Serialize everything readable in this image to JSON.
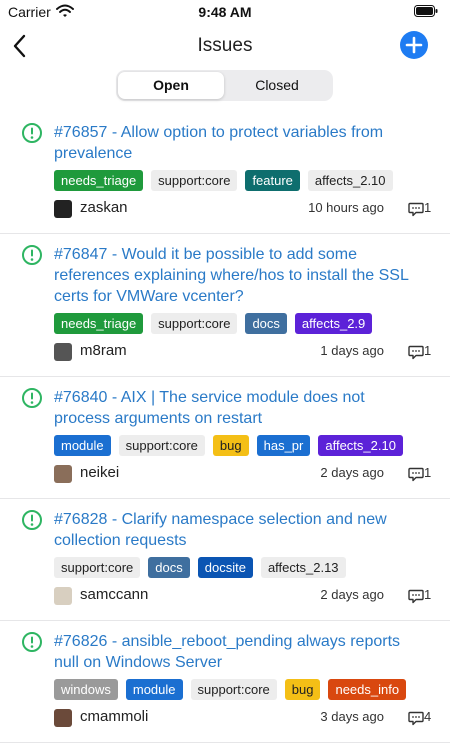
{
  "status_bar": {
    "carrier": "Carrier",
    "time": "9:48 AM"
  },
  "nav": {
    "title": "Issues"
  },
  "tabs": [
    {
      "label": "Open",
      "selected": true
    },
    {
      "label": "Closed",
      "selected": false
    }
  ],
  "colors": {
    "accent": "#1e7cf2",
    "issue_link": "#2a7ac7",
    "open_icon": "#2eb562"
  },
  "issues": [
    {
      "title": "#76857 - Allow option to protect variables from prevalence",
      "labels": [
        {
          "text": "needs_triage",
          "bg": "#1f9a3c",
          "fg": "#ffffff"
        },
        {
          "text": "support:core",
          "bg": "#ededed",
          "fg": "#222222"
        },
        {
          "text": "feature",
          "bg": "#0e6e6e",
          "fg": "#ffffff"
        },
        {
          "text": "affects_2.10",
          "bg": "#ededed",
          "fg": "#222222"
        }
      ],
      "author": "zaskan",
      "avatar_color": "#222222",
      "time": "10 hours ago",
      "comments": "1"
    },
    {
      "title": "#76847 - Would it be possible to add some references explaining where/hos to install the SSL certs for VMWare vcenter?",
      "labels": [
        {
          "text": "needs_triage",
          "bg": "#1f9a3c",
          "fg": "#ffffff"
        },
        {
          "text": "support:core",
          "bg": "#ededed",
          "fg": "#222222"
        },
        {
          "text": "docs",
          "bg": "#3f6f9f",
          "fg": "#ffffff"
        },
        {
          "text": "affects_2.9",
          "bg": "#5c22d8",
          "fg": "#ffffff"
        }
      ],
      "author": "m8ram",
      "avatar_color": "#555555",
      "time": "1 days ago",
      "comments": "1"
    },
    {
      "title": "#76840 - AIX | The service module does not process arguments on restart",
      "labels": [
        {
          "text": "module",
          "bg": "#1b6fd1",
          "fg": "#ffffff"
        },
        {
          "text": "support:core",
          "bg": "#ededed",
          "fg": "#222222"
        },
        {
          "text": "bug",
          "bg": "#f4bf16",
          "fg": "#222222"
        },
        {
          "text": "has_pr",
          "bg": "#1b6fd1",
          "fg": "#ffffff"
        },
        {
          "text": "affects_2.10",
          "bg": "#5c22d8",
          "fg": "#ffffff"
        }
      ],
      "author": "neikei",
      "avatar_color": "#8a6e5a",
      "time": "2 days ago",
      "comments": "1"
    },
    {
      "title": "#76828 - Clarify namespace selection and new collection requests",
      "labels": [
        {
          "text": "support:core",
          "bg": "#ededed",
          "fg": "#222222"
        },
        {
          "text": "docs",
          "bg": "#3f6f9f",
          "fg": "#ffffff"
        },
        {
          "text": "docsite",
          "bg": "#0b55b3",
          "fg": "#ffffff"
        },
        {
          "text": "affects_2.13",
          "bg": "#ededed",
          "fg": "#222222"
        }
      ],
      "author": "samccann",
      "avatar_color": "#d8cfc0",
      "time": "2 days ago",
      "comments": "1"
    },
    {
      "title": "#76826 - ansible_reboot_pending always reports null on Windows Server",
      "labels": [
        {
          "text": "windows",
          "bg": "#9a9a9a",
          "fg": "#ffffff"
        },
        {
          "text": "module",
          "bg": "#1b6fd1",
          "fg": "#ffffff"
        },
        {
          "text": "support:core",
          "bg": "#ededed",
          "fg": "#222222"
        },
        {
          "text": "bug",
          "bg": "#f4bf16",
          "fg": "#222222"
        },
        {
          "text": "needs_info",
          "bg": "#d9480f",
          "fg": "#ffffff"
        }
      ],
      "author": "cmammoli",
      "avatar_color": "#6b4a3a",
      "time": "3 days ago",
      "comments": "4"
    }
  ]
}
